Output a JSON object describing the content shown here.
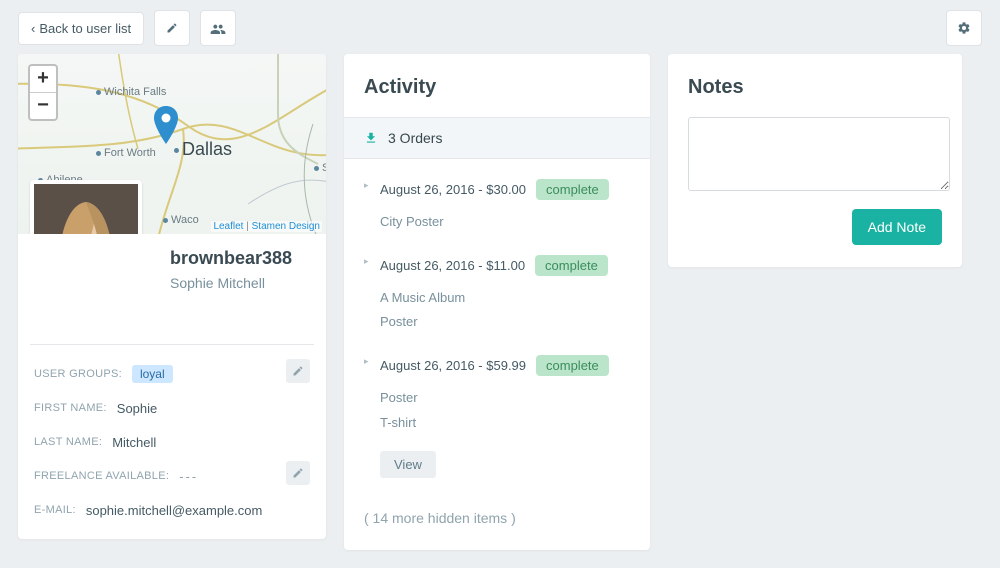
{
  "topbar": {
    "back_label": "Back to user list"
  },
  "map": {
    "cities": {
      "wichita_falls": "Wichita Falls",
      "fort_worth": "Fort Worth",
      "dallas": "Dallas",
      "abilene": "Abilene",
      "waco": "Waco",
      "sh": "S"
    },
    "attribution_leaflet": "Leaflet",
    "attribution_sep": " | ",
    "attribution_stamen": "Stamen Design"
  },
  "profile": {
    "username": "brownbear388",
    "fullname": "Sophie Mitchell",
    "fields": {
      "user_groups_label": "User groups:",
      "user_groups_value": "loyal",
      "first_name_label": "First name:",
      "first_name_value": "Sophie",
      "last_name_label": "Last name:",
      "last_name_value": "Mitchell",
      "freelance_label": "Freelance available:",
      "freelance_value": "---",
      "email_label": "E-mail:",
      "email_value": "sophie.mitchell@example.com"
    }
  },
  "activity": {
    "title": "Activity",
    "orders_header": "3 Orders",
    "orders": [
      {
        "date": "August 26, 2016",
        "amount": "$30.00",
        "status": "complete",
        "items": [
          "City Poster"
        ]
      },
      {
        "date": "August 26, 2016",
        "amount": "$11.00",
        "status": "complete",
        "items": [
          "A Music Album",
          "Poster"
        ]
      },
      {
        "date": "August 26, 2016",
        "amount": "$59.99",
        "status": "complete",
        "items": [
          "Poster",
          "T-shirt"
        ]
      }
    ],
    "view_label": "View",
    "hidden_more": "( 14 more hidden items )"
  },
  "notes": {
    "title": "Notes",
    "add_label": "Add Note"
  }
}
